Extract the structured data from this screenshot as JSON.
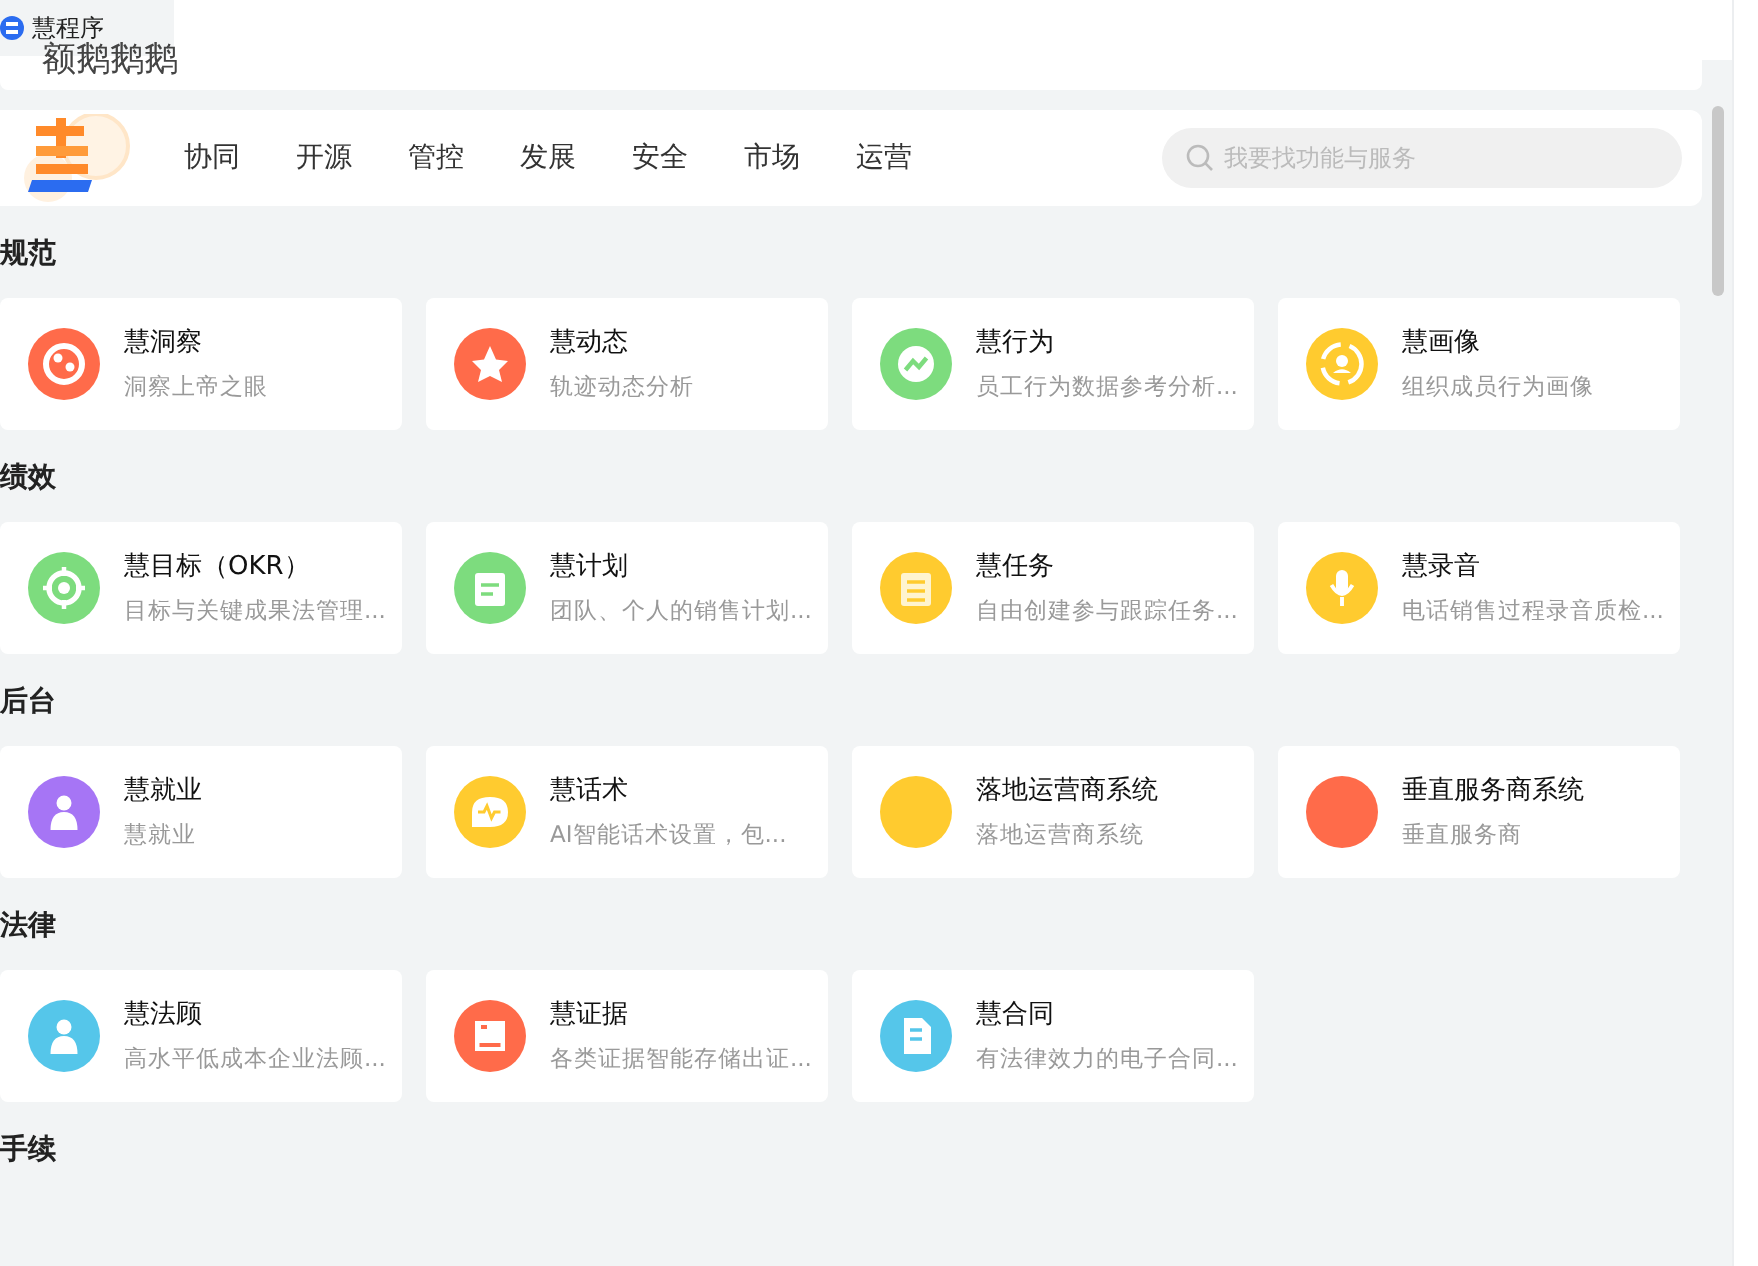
{
  "app_tab": {
    "title": "慧程序"
  },
  "overlay_text": "额鹅鹅鹅",
  "nav": {
    "items": [
      {
        "label": "协同"
      },
      {
        "label": "开源"
      },
      {
        "label": "管控"
      },
      {
        "label": "发展"
      },
      {
        "label": "安全"
      },
      {
        "label": "市场"
      },
      {
        "label": "运营"
      }
    ],
    "search": {
      "placeholder": "我要找功能与服务"
    }
  },
  "sections": [
    {
      "title": "规范",
      "items": [
        {
          "title": "慧洞察",
          "desc": "洞察上帝之眼",
          "color": "#ff6b4a",
          "kind": "network"
        },
        {
          "title": "慧动态",
          "desc": "轨迹动态分析",
          "color": "#ff6b4a",
          "kind": "star"
        },
        {
          "title": "慧行为",
          "desc": "员工行为数据参考分析...",
          "color": "#7ddc7e",
          "kind": "trend"
        },
        {
          "title": "慧画像",
          "desc": "组织成员行为画像",
          "color": "#ffcb2f",
          "kind": "user"
        }
      ]
    },
    {
      "title": "绩效",
      "items": [
        {
          "title": "慧目标（OKR）",
          "desc": "目标与关键成果法管理...",
          "color": "#7ddc7e",
          "kind": "target"
        },
        {
          "title": "慧计划",
          "desc": "团队、个人的销售计划...",
          "color": "#7ddc7e",
          "kind": "calendar"
        },
        {
          "title": "慧任务",
          "desc": "自由创建参与跟踪任务...",
          "color": "#ffcb2f",
          "kind": "stack"
        },
        {
          "title": "慧录音",
          "desc": "电话销售过程录音质检...",
          "color": "#ffcb2f",
          "kind": "mic"
        }
      ]
    },
    {
      "title": "后台",
      "items": [
        {
          "title": "慧就业",
          "desc": "慧就业",
          "color": "#a675f5",
          "kind": "person"
        },
        {
          "title": "慧话术",
          "desc": "AI智能话术设置，包...",
          "color": "#ffcb2f",
          "kind": "chat"
        },
        {
          "title": "落地运营商系统",
          "desc": "落地运营商系统",
          "color": "#ffcb2f",
          "kind": "plain"
        },
        {
          "title": "垂直服务商系统",
          "desc": "垂直服务商",
          "color": "#ff6b4a",
          "kind": "plain"
        }
      ]
    },
    {
      "title": "法律",
      "items": [
        {
          "title": "慧法顾",
          "desc": "高水平低成本企业法顾...",
          "color": "#55c6ea",
          "kind": "person"
        },
        {
          "title": "慧证据",
          "desc": "各类证据智能存储出证...",
          "color": "#ff6b4a",
          "kind": "picture"
        },
        {
          "title": "慧合同",
          "desc": "有法律效力的电子合同...",
          "color": "#55c6ea",
          "kind": "doc"
        }
      ]
    },
    {
      "title": "手续"
    }
  ]
}
